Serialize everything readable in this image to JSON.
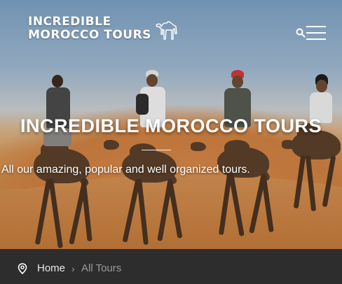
{
  "header": {
    "logo_line1": "INCREDIBLE",
    "logo_line2": "MOROCCO TOURS",
    "icons": [
      "camel-logo-icon",
      "search-icon",
      "menu-icon"
    ]
  },
  "hero": {
    "title": "INCREDIBLE MOROCCO TOURS",
    "subtitle": "All our amazing, popular and well organized tours."
  },
  "breadcrumb": {
    "home_label": "Home",
    "separator": "›",
    "current_label": "All Tours"
  },
  "colors": {
    "text": "#ffffff",
    "breadcrumb_bg": "#2d2d2d",
    "breadcrumb_muted": "#9a9a9a"
  }
}
